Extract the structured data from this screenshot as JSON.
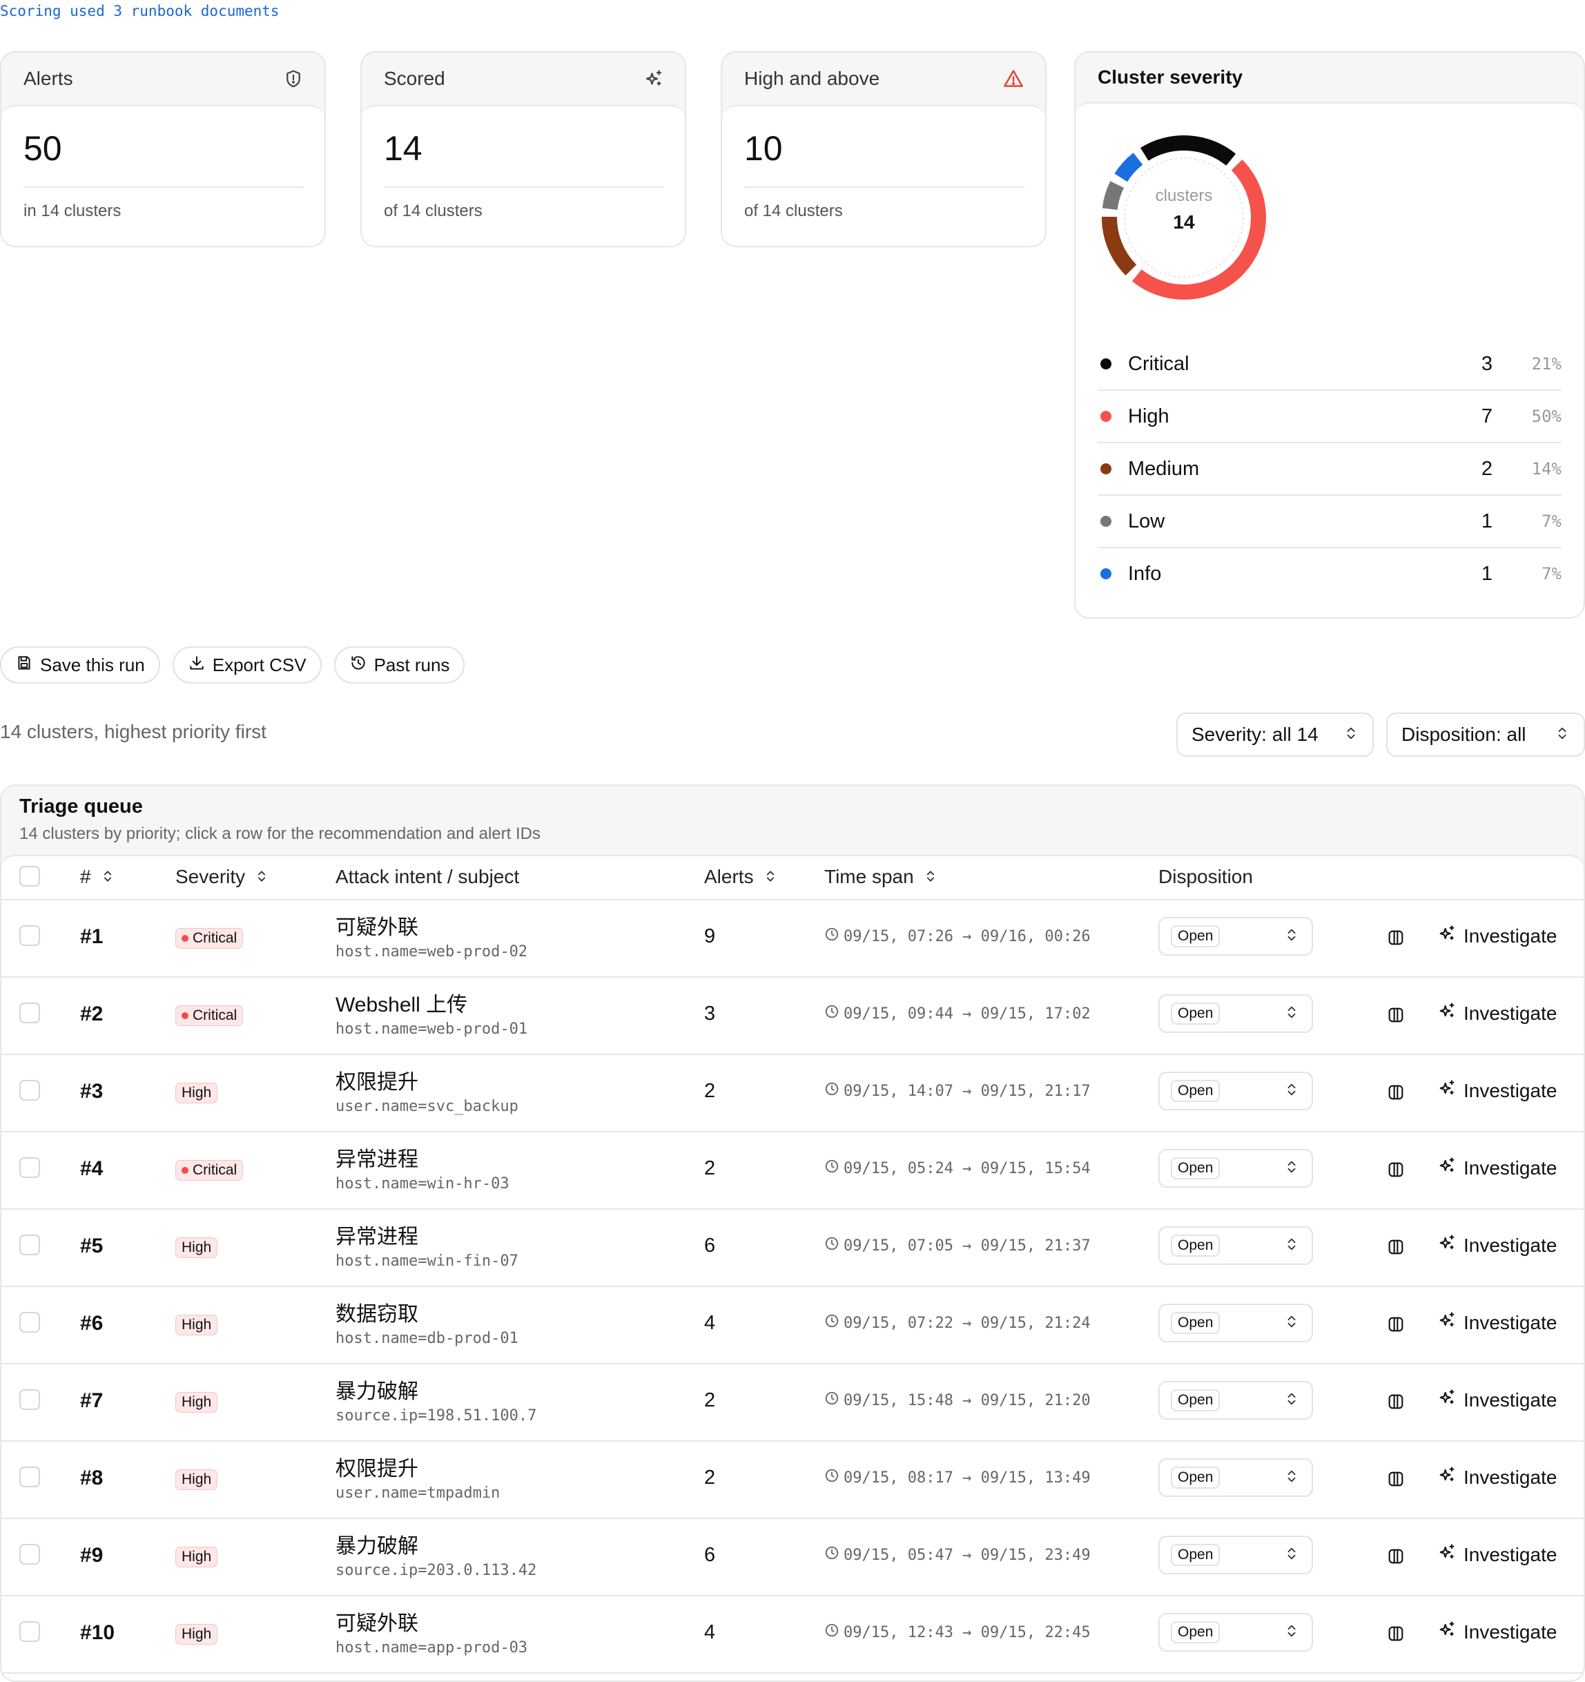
{
  "note": "Scoring used 3 runbook documents",
  "cards": [
    {
      "title": "Alerts",
      "value": "50",
      "sub": "in 14 clusters",
      "icon": "shield-icon"
    },
    {
      "title": "Scored",
      "value": "14",
      "sub": "of 14 clusters",
      "icon": "sparkles-icon"
    },
    {
      "title": "High and above",
      "value": "10",
      "sub": "of 14 clusters",
      "icon": "warning-triangle-icon"
    }
  ],
  "severity_card": {
    "title": "Cluster severity",
    "center_label": "clusters",
    "center_value": "14",
    "items": [
      {
        "name": "Critical",
        "count": "3",
        "pct": "21%",
        "value": 3,
        "color": "#0a0a0a"
      },
      {
        "name": "High",
        "count": "7",
        "pct": "50%",
        "value": 7,
        "color": "#f5524b"
      },
      {
        "name": "Medium",
        "count": "2",
        "pct": "14%",
        "value": 2,
        "color": "#8b3a12"
      },
      {
        "name": "Low",
        "count": "1",
        "pct": "7%",
        "value": 1,
        "color": "#777777"
      },
      {
        "name": "Info",
        "count": "1",
        "pct": "7%",
        "value": 1,
        "color": "#1a6fe0"
      }
    ]
  },
  "actions": {
    "save": "Save this run",
    "export": "Export CSV",
    "past": "Past runs"
  },
  "summary": "14 clusters, highest priority first",
  "filters": {
    "severity": "Severity: all 14",
    "disposition": "Disposition: all"
  },
  "queue": {
    "title": "Triage queue",
    "subtitle": "14 clusters by priority; click a row for the recommendation and alert IDs",
    "headers": {
      "rank": "#",
      "severity": "Severity",
      "intent": "Attack intent / subject",
      "alerts": "Alerts",
      "span": "Time span",
      "disposition": "Disposition"
    },
    "investigate_label": "Investigate",
    "rows": [
      {
        "rank": "#1",
        "severity": "Critical",
        "intent": "可疑外联",
        "subject": "host.name=web-prod-02",
        "alerts": "9",
        "span": "09/15, 07:26 → 09/16, 00:26",
        "disposition": "Open"
      },
      {
        "rank": "#2",
        "severity": "Critical",
        "intent": "Webshell 上传",
        "subject": "host.name=web-prod-01",
        "alerts": "3",
        "span": "09/15, 09:44 → 09/15, 17:02",
        "disposition": "Open"
      },
      {
        "rank": "#3",
        "severity": "High",
        "intent": "权限提升",
        "subject": "user.name=svc_backup",
        "alerts": "2",
        "span": "09/15, 14:07 → 09/15, 21:17",
        "disposition": "Open"
      },
      {
        "rank": "#4",
        "severity": "Critical",
        "intent": "异常进程",
        "subject": "host.name=win-hr-03",
        "alerts": "2",
        "span": "09/15, 05:24 → 09/15, 15:54",
        "disposition": "Open"
      },
      {
        "rank": "#5",
        "severity": "High",
        "intent": "异常进程",
        "subject": "host.name=win-fin-07",
        "alerts": "6",
        "span": "09/15, 07:05 → 09/15, 21:37",
        "disposition": "Open"
      },
      {
        "rank": "#6",
        "severity": "High",
        "intent": "数据窃取",
        "subject": "host.name=db-prod-01",
        "alerts": "4",
        "span": "09/15, 07:22 → 09/15, 21:24",
        "disposition": "Open"
      },
      {
        "rank": "#7",
        "severity": "High",
        "intent": "暴力破解",
        "subject": "source.ip=198.51.100.7",
        "alerts": "2",
        "span": "09/15, 15:48 → 09/15, 21:20",
        "disposition": "Open"
      },
      {
        "rank": "#8",
        "severity": "High",
        "intent": "权限提升",
        "subject": "user.name=tmpadmin",
        "alerts": "2",
        "span": "09/15, 08:17 → 09/15, 13:49",
        "disposition": "Open"
      },
      {
        "rank": "#9",
        "severity": "High",
        "intent": "暴力破解",
        "subject": "source.ip=203.0.113.42",
        "alerts": "6",
        "span": "09/15, 05:47 → 09/15, 23:49",
        "disposition": "Open"
      },
      {
        "rank": "#10",
        "severity": "High",
        "intent": "可疑外联",
        "subject": "host.name=app-prod-03",
        "alerts": "4",
        "span": "09/15, 12:43 → 09/15, 22:45",
        "disposition": "Open"
      }
    ]
  }
}
